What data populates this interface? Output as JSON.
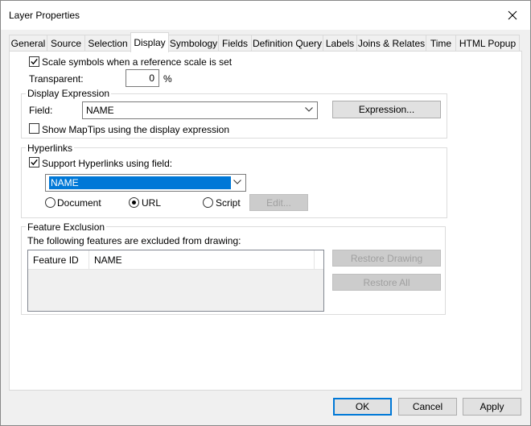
{
  "window": {
    "title": "Layer Properties"
  },
  "tabs": [
    {
      "label": "General"
    },
    {
      "label": "Source"
    },
    {
      "label": "Selection"
    },
    {
      "label": "Display"
    },
    {
      "label": "Symbology"
    },
    {
      "label": "Fields"
    },
    {
      "label": "Definition Query"
    },
    {
      "label": "Labels"
    },
    {
      "label": "Joins & Relates"
    },
    {
      "label": "Time"
    },
    {
      "label": "HTML Popup"
    }
  ],
  "display": {
    "scale_symbols_label": "Scale symbols when a reference scale is set",
    "scale_symbols_checked": true,
    "transparent_label": "Transparent:",
    "transparent_value": "0",
    "percent": "%"
  },
  "display_expression": {
    "group_title": "Display Expression",
    "field_label": "Field:",
    "field_value": "NAME",
    "expression_button": "Expression...",
    "maptips_label": "Show MapTips using the display expression",
    "maptips_checked": false
  },
  "hyperlinks": {
    "group_title": "Hyperlinks",
    "support_label": "Support Hyperlinks using field:",
    "support_checked": true,
    "field_value": "NAME",
    "options": [
      "Document",
      "URL",
      "Script"
    ],
    "selected_option": "URL",
    "edit_button": "Edit..."
  },
  "feature_exclusion": {
    "group_title": "Feature Exclusion",
    "description": "The following features are excluded from drawing:",
    "columns": [
      "Feature ID",
      "NAME"
    ],
    "restore_drawing_button": "Restore Drawing",
    "restore_all_button": "Restore All"
  },
  "footer": {
    "ok": "OK",
    "cancel": "Cancel",
    "apply": "Apply"
  }
}
